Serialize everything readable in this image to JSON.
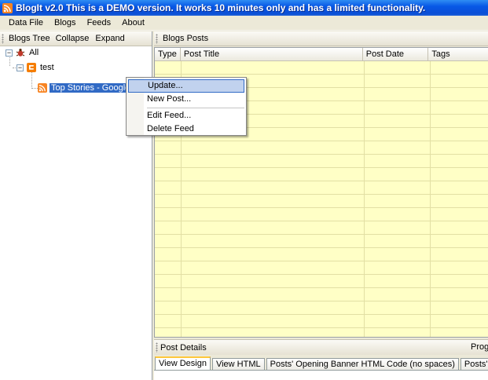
{
  "window": {
    "title": "BlogIt v2.0 This is a DEMO version. It works 10 minutes only and has a limited functionality."
  },
  "menu": [
    "Data File",
    "Blogs",
    "Feeds",
    "About"
  ],
  "left_toolbar": {
    "label": "Blogs Tree",
    "collapse": "Collapse",
    "expand": "Expand"
  },
  "tree": {
    "root": "All",
    "blog": "test",
    "feed": "Top Stories - Google News"
  },
  "context_menu": {
    "update": "Update...",
    "new_post": "New Post...",
    "edit_feed": "Edit Feed...",
    "delete_feed": "Delete Feed"
  },
  "posts": {
    "header": "Blogs Posts",
    "columns": [
      "Type",
      "Post Title",
      "Post Date",
      "Tags"
    ]
  },
  "details": {
    "label": "Post Details",
    "progress": "Progress"
  },
  "tabs": [
    "View Design",
    "View HTML",
    "Posts' Opening Banner HTML Code (no spaces)",
    "Posts' Closing Banner HTML Code"
  ],
  "colors": {
    "grid_background": "#ffffc6",
    "selection": "#316ac5",
    "rss_orange": "#f78422",
    "titlebar": "#0a4fd6"
  }
}
